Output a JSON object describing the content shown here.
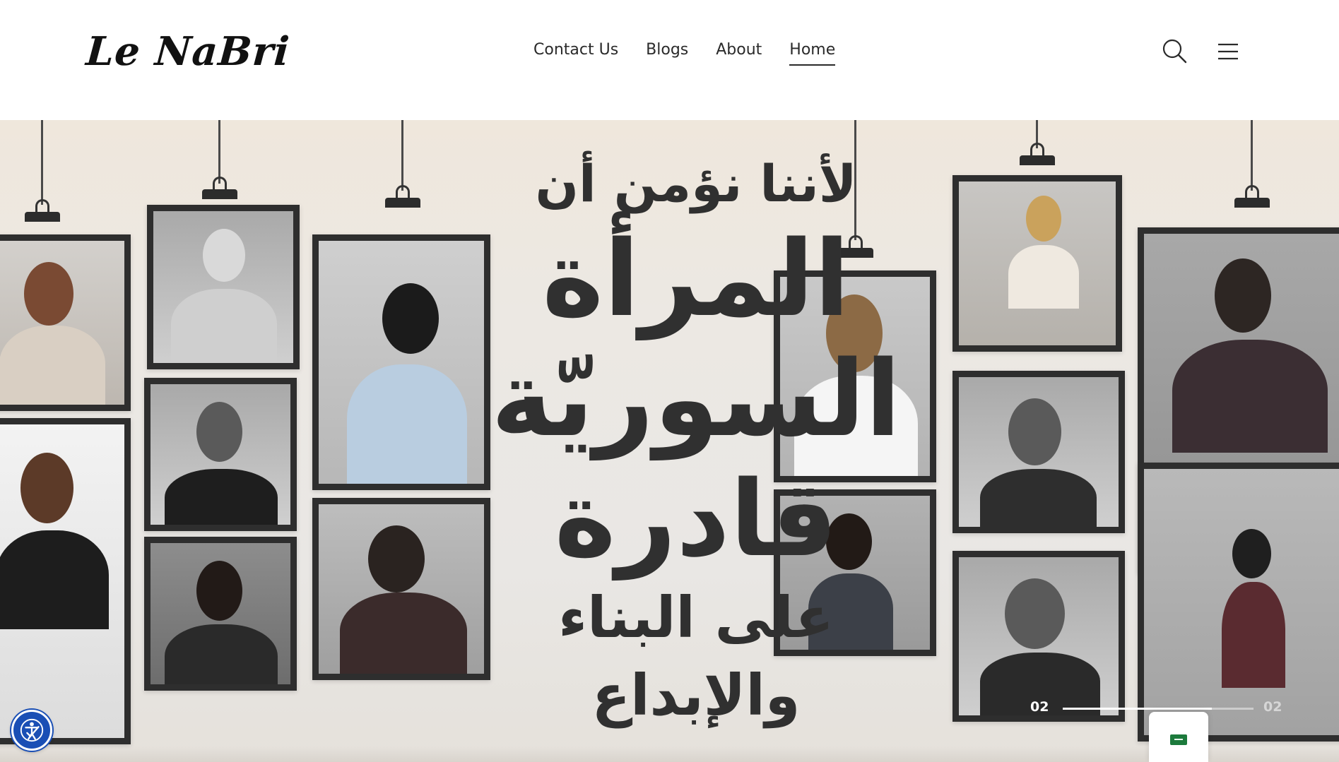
{
  "brand": {
    "logo_text": "Le NaBri"
  },
  "nav": {
    "items": [
      {
        "label": "Contact Us",
        "active": false
      },
      {
        "label": "Blogs",
        "active": false
      },
      {
        "label": "About",
        "active": false
      },
      {
        "label": "Home",
        "active": true
      }
    ]
  },
  "header": {
    "search_icon": "search-icon",
    "menu_icon": "hamburger-menu-icon"
  },
  "hero": {
    "headline_lines": [
      "لأننا نؤمن أن",
      "المرأة",
      "السوريّة",
      "قادرة",
      "على البناء والإبداع"
    ],
    "slider": {
      "current": "02",
      "total": "02",
      "progress": 0.78
    }
  },
  "language_tab": {
    "icon": "saudi-flag-icon"
  },
  "accessibility": {
    "icon": "accessibility-icon"
  },
  "colors": {
    "text": "#2a2a2a",
    "accessibility_blue": "#1a4fb5",
    "flag_green": "#1c7a3c"
  }
}
